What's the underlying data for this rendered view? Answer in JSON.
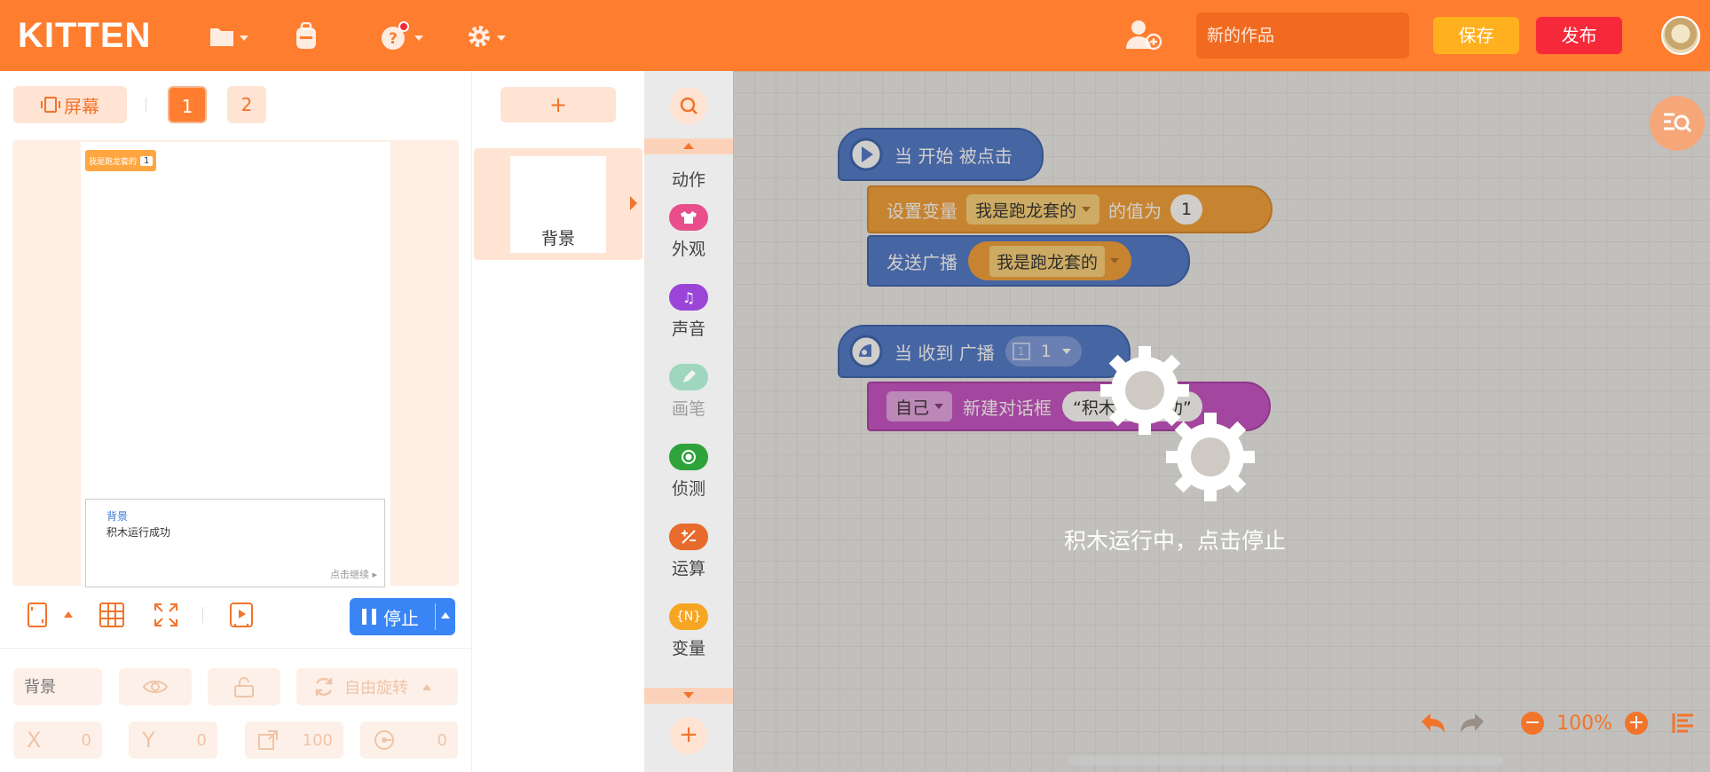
{
  "topbar": {
    "logo": "KITTEN",
    "project_name": "新的作品",
    "save_label": "保存",
    "publish_label": "发布"
  },
  "stage_panel": {
    "screen_label": "屏幕",
    "scene_tabs": [
      "1",
      "2"
    ],
    "variable_monitor": {
      "name": "我是跑龙套的",
      "value": "1"
    },
    "dialog": {
      "speaker": "背景",
      "message": "积木运行成功",
      "continue": "点击继续"
    },
    "stop_label": "停止",
    "props": {
      "name_placeholder": "背景",
      "rotation_mode": "自由旋转",
      "x_label": "X",
      "x_value": "0",
      "y_label": "Y",
      "y_value": "0",
      "size_value": "100",
      "direction_value": "0"
    }
  },
  "sprites": {
    "add_label": "+",
    "items": [
      {
        "name": "背景"
      }
    ]
  },
  "categories": [
    {
      "label": "动作",
      "icon": "motion-icon",
      "color": "#f3a03a"
    },
    {
      "label": "外观",
      "icon": "shirt-icon",
      "color": "#e94e8c"
    },
    {
      "label": "声音",
      "icon": "music-icon",
      "color": "#9a45d8"
    },
    {
      "label": "画笔",
      "icon": "pen-icon",
      "color": "#44c08a"
    },
    {
      "label": "侦测",
      "icon": "sensing-icon",
      "color": "#2ea33a"
    },
    {
      "label": "运算",
      "icon": "operator-icon",
      "color": "#e86a2c"
    },
    {
      "label": "变量",
      "icon": "variable-icon",
      "color": "#f6a623",
      "glyph": "{N}"
    }
  ],
  "scripts": {
    "script1": {
      "hat": "当 开始 被点击",
      "set_var_label": "设置变量",
      "set_var_name": "我是跑龙套的",
      "set_var_to": "的值为",
      "set_var_value": "1",
      "broadcast_label": "发送广播",
      "broadcast_name": "我是跑龙套的"
    },
    "script2": {
      "hat": "当 收到 广播",
      "hat_value": "1",
      "self_label": "自己",
      "dialog_label": "新建对话框",
      "dialog_text": "“积木运行成功”"
    }
  },
  "running_overlay": {
    "text": "积木运行中，点击停止"
  },
  "zoom": {
    "level": "100%"
  }
}
